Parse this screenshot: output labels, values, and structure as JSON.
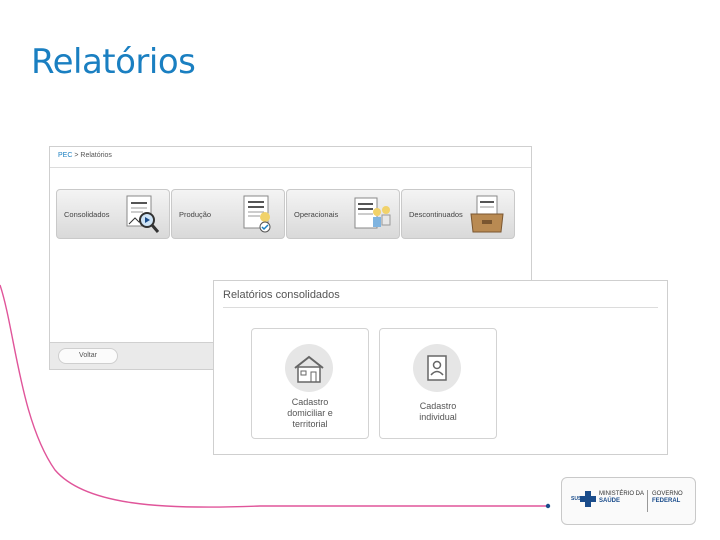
{
  "slide": {
    "title": "Relatórios"
  },
  "main_screen": {
    "breadcrumb_root": "PEC",
    "breadcrumb_sep": ">",
    "breadcrumb_current": "Relatórios",
    "cards": [
      {
        "label": "Consolidados",
        "icon": "report-magnifier-icon"
      },
      {
        "label": "Produção",
        "icon": "report-production-icon"
      },
      {
        "label": "Operacionais",
        "icon": "report-people-icon"
      },
      {
        "label": "Descontinuados",
        "icon": "report-drawer-icon"
      }
    ],
    "back_button": "Voltar"
  },
  "consolidated_screen": {
    "title": "Relatórios consolidados",
    "tiles": [
      {
        "line1": "Cadastro",
        "line2": "domiciliar e",
        "line3": "territorial",
        "icon": "house-icon"
      },
      {
        "line1": "Cadastro",
        "line2": "individual",
        "line3": "",
        "icon": "person-card-icon"
      }
    ]
  },
  "logo": {
    "sus": "SUS",
    "ministry_line1": "MINISTÉRIO DA",
    "ministry_line2": "SAÚDE",
    "gov_line1": "GOVERNO",
    "gov_line2": "FEDERAL"
  },
  "colors": {
    "title": "#1a7fc1",
    "deco_line": "#e0559a",
    "brand_blue": "#1a4c8b"
  }
}
